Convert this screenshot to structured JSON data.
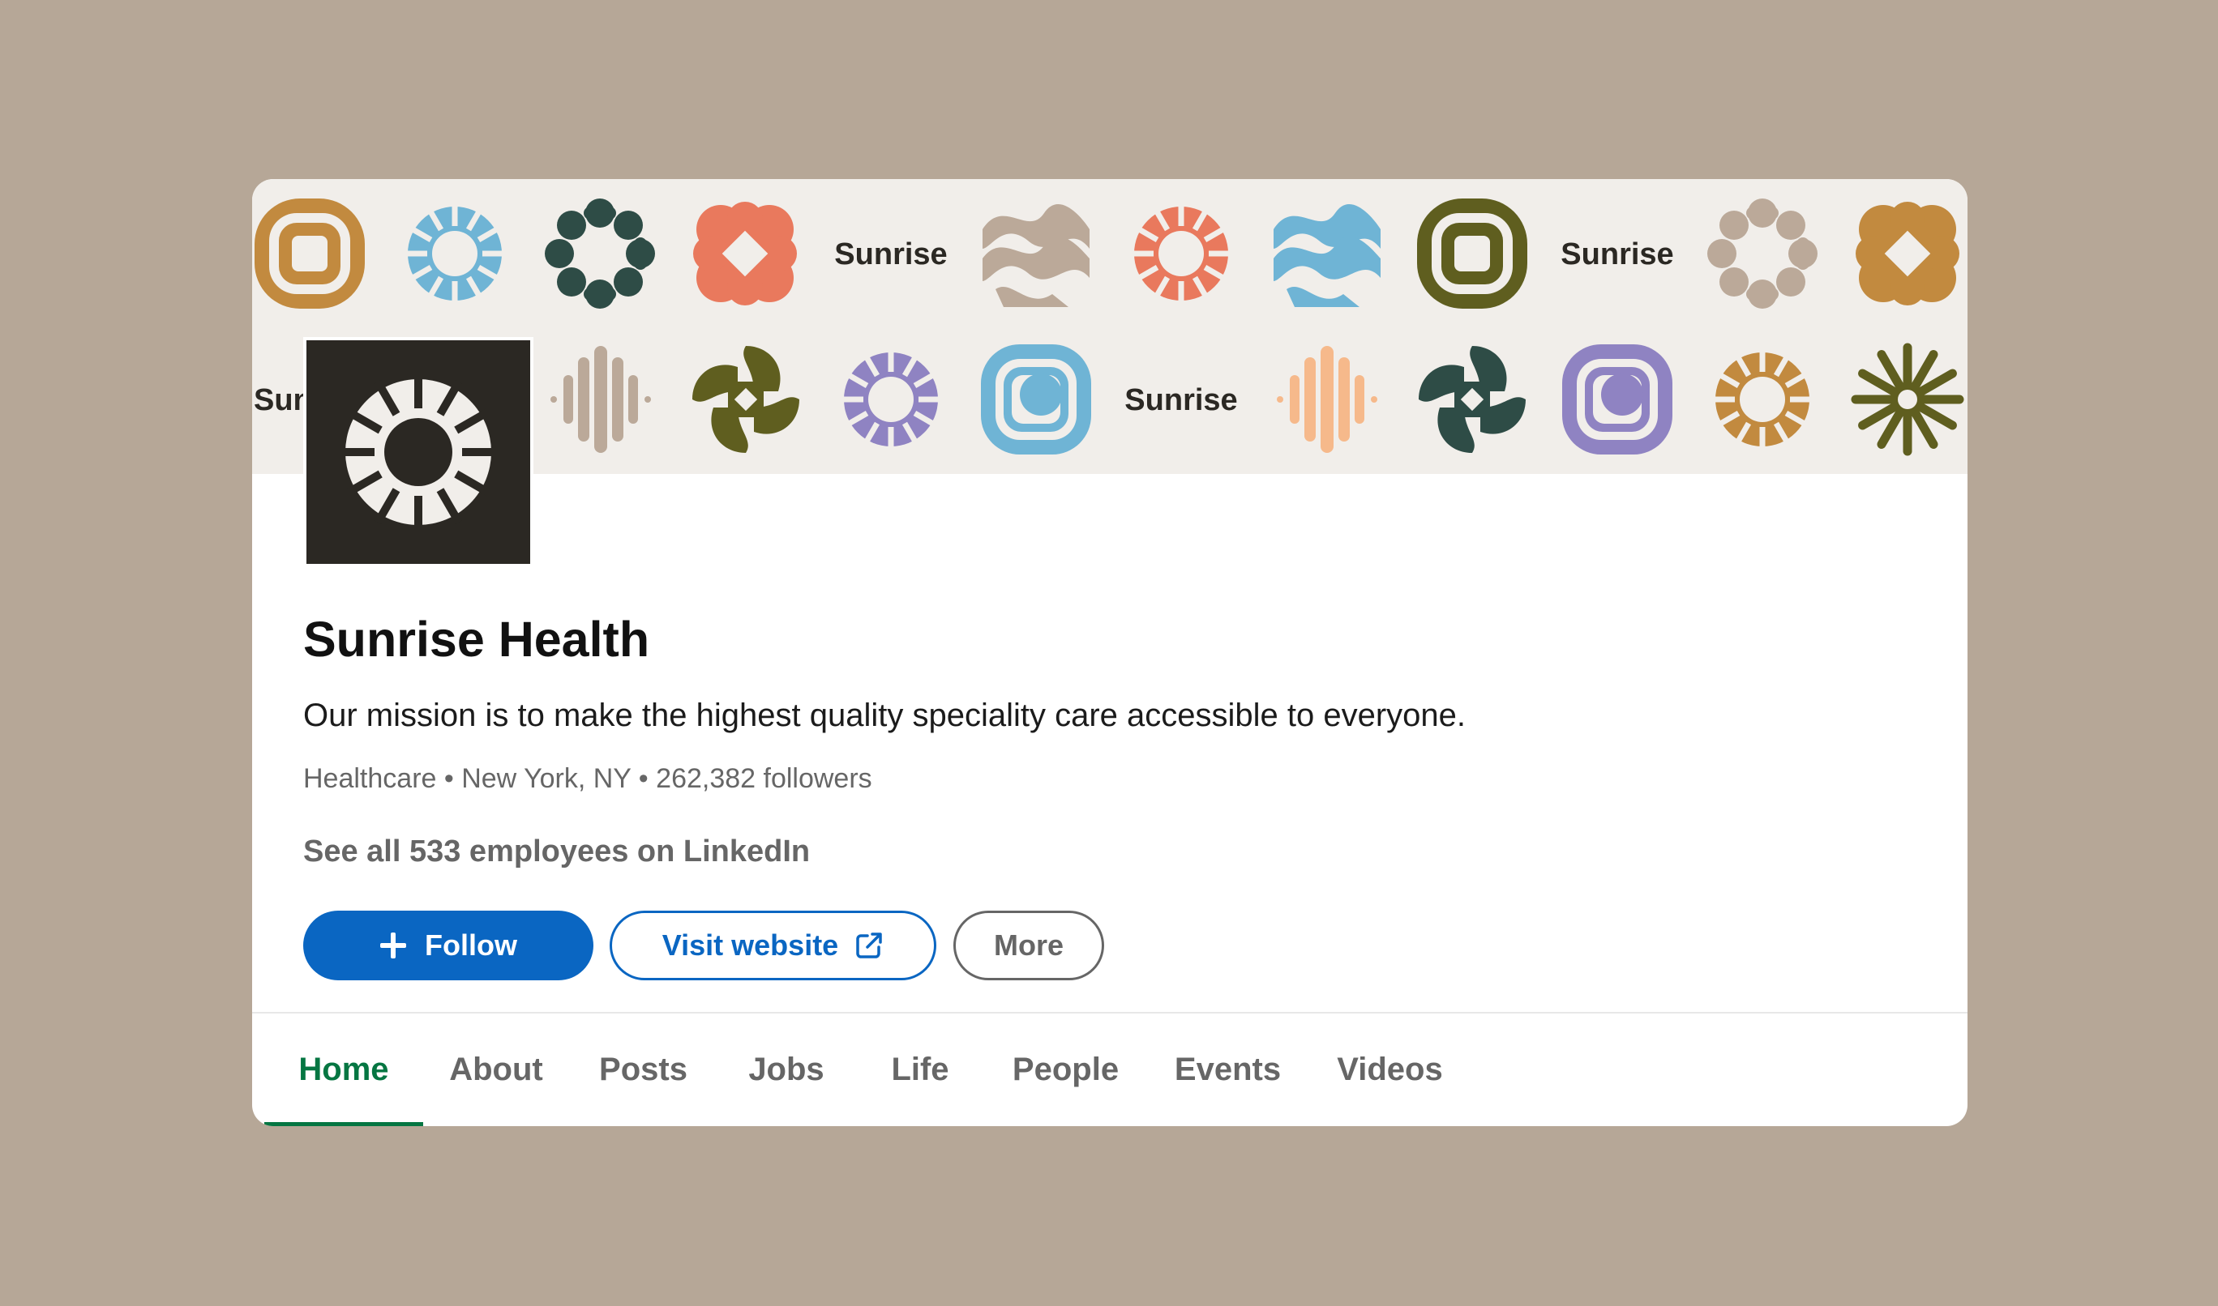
{
  "colors": {
    "page_background": "#b6a797",
    "banner_background": "#f1eeea",
    "brand_dark": "#2b2823",
    "primary_blue": "#0a66c2",
    "active_tab_green": "#057642",
    "muted_gray": "#666666"
  },
  "banner": {
    "wordmark": "Sunrise",
    "row1_icons": [
      "ochre-square-rings-icon",
      "blue-gear-ring-icon",
      "dark-green-blob-ring-icon",
      "coral-flower-icon",
      "wordmark",
      "taupe-wave-icon",
      "coral-gear-ring-icon",
      "blue-wave-icon",
      "olive-square-rings-icon",
      "wordmark",
      "taupe-blob-ring-icon",
      "ochre-flower-icon"
    ],
    "row2_icons": [
      "wordmark-partial",
      "taupe-sound-bars-icon",
      "olive-pinwheel-icon",
      "purple-gear-ring-icon",
      "blue-rounded-square-icon",
      "wordmark",
      "peach-sound-bars-icon",
      "dark-green-pinwheel-icon",
      "purple-rounded-square-icon",
      "ochre-gear-ring-icon",
      "olive-asterisk-icon"
    ]
  },
  "company": {
    "logo_icon": "sunrise-gear-ring-logo",
    "name": "Sunrise Health",
    "tagline": "Our mission is to make the highest quality speciality care accessible to everyone.",
    "meta": "Healthcare • New York, NY • 262,382 followers",
    "employees_link": "See all 533 employees on LinkedIn"
  },
  "actions": {
    "follow_label": "Follow",
    "follow_icon": "plus-icon",
    "visit_label": "Visit website",
    "visit_icon": "external-link-icon",
    "more_label": "More"
  },
  "tabs": [
    {
      "label": "Home",
      "active": true
    },
    {
      "label": "About",
      "active": false
    },
    {
      "label": "Posts",
      "active": false
    },
    {
      "label": "Jobs",
      "active": false
    },
    {
      "label": "Life",
      "active": false
    },
    {
      "label": "People",
      "active": false
    },
    {
      "label": "Events",
      "active": false
    },
    {
      "label": "Videos",
      "active": false
    }
  ]
}
